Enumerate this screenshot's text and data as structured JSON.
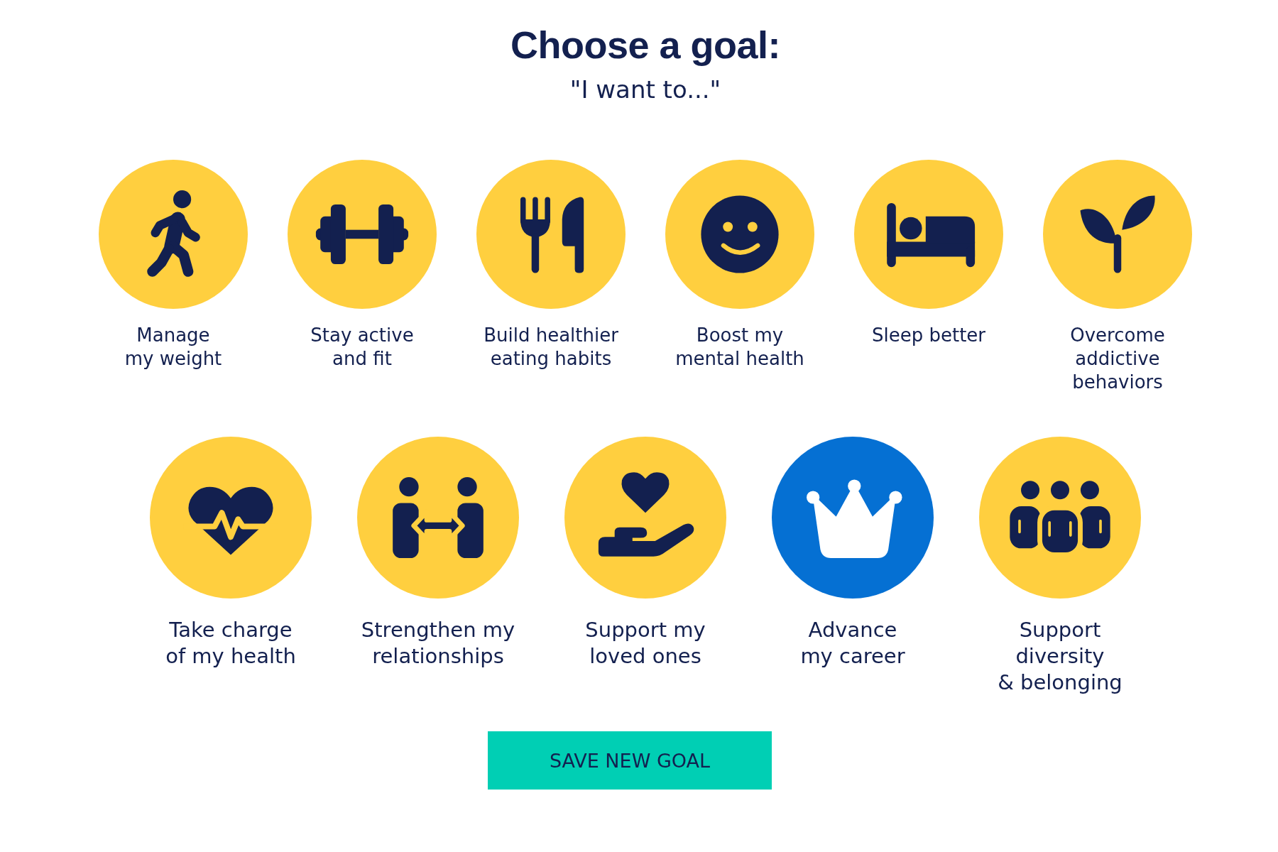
{
  "title": "Choose a goal:",
  "subtitle": "\"I want to...\"",
  "goal_rows": [
    [
      {
        "label": "Manage\nmy weight",
        "selected": false
      },
      {
        "label": "Stay active\nand fit",
        "selected": false
      },
      {
        "label": "Build healthier\neating habits",
        "selected": false
      },
      {
        "label": "Boost my\nmental health",
        "selected": false
      },
      {
        "label": "Sleep better",
        "selected": false
      },
      {
        "label": "Overcome\naddictive\nbehaviors",
        "selected": false
      }
    ],
    [
      {
        "label": "Take charge\nof my health",
        "selected": false
      },
      {
        "label": "Strengthen my\nrelationships",
        "selected": false
      },
      {
        "label": "Support my\nloved ones",
        "selected": false
      },
      {
        "label": "Advance\nmy career",
        "selected": true
      },
      {
        "label": "Support\ndiversity\n& belonging",
        "selected": false
      }
    ]
  ],
  "save_button": {
    "label": "SAVE NEW GOAL"
  }
}
